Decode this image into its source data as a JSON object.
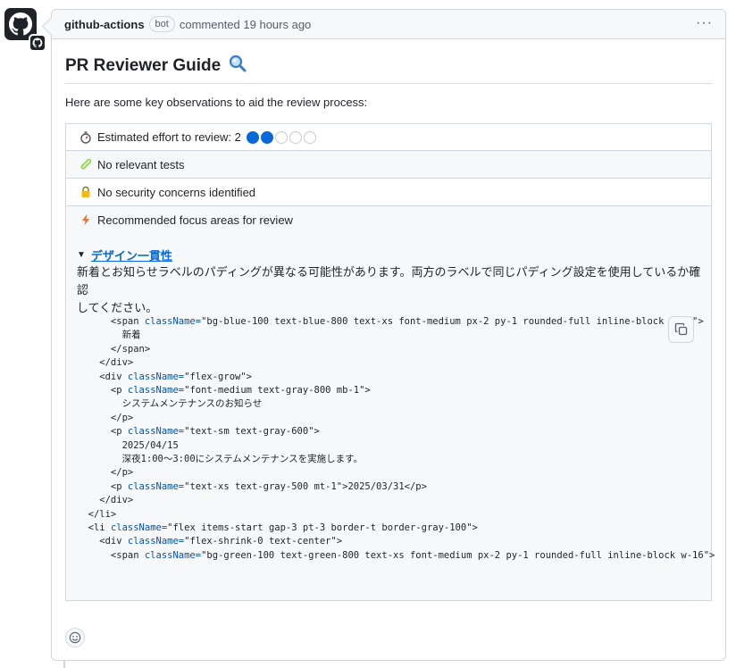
{
  "comment": {
    "author": "github-actions",
    "badge": "bot",
    "action": "commented",
    "time": "19 hours ago",
    "menu_glyph": "···"
  },
  "guide": {
    "title": "PR Reviewer Guide",
    "title_icon": "magnifier-icon",
    "intro": "Here are some key observations to aid the review process:"
  },
  "observations": {
    "effort_label": "Estimated effort to review: 2",
    "effort_level": 2,
    "effort_max": 5,
    "tests_label": "No relevant tests",
    "security_label": "No security concerns identified",
    "focus_label": "Recommended focus areas for review"
  },
  "focus": {
    "summary_link": "デザイン一貫性",
    "description_line1": "新着とお知らせラベルのパディングが異なる可能性があります。両方のラベルで同じパディング設定を使用しているか確認",
    "description_line2": "してください。"
  },
  "code_lines": [
    "      <span className=\"bg-blue-100 text-blue-800 text-xs font-medium px-2 py-1 rounded-full inline-block w-16\">",
    "        新着",
    "      </span>",
    "    </div>",
    "    <div className=\"flex-grow\">",
    "      <p className=\"font-medium text-gray-800 mb-1\">",
    "        システムメンテナンスのお知らせ",
    "      </p>",
    "      <p className=\"text-sm text-gray-600\">",
    "        2025/04/15",
    "        深夜1:00～3:00にシステムメンテナンスを実施します。",
    "      </p>",
    "      <p className=\"text-xs text-gray-500 mt-1\">2025/03/31</p>",
    "    </div>",
    "  </li>",
    "  <li className=\"flex items-start gap-3 pt-3 border-t border-gray-100\">",
    "    <div className=\"flex-shrink-0 text-center\">",
    "      <span className=\"bg-green-100 text-green-800 text-xs font-medium px-2 py-1 rounded-full inline-block w-16\">"
  ],
  "colors": {
    "accent": "#0969da",
    "attr": "#0550ae",
    "border": "#d0d7de",
    "muted": "#57606a"
  }
}
